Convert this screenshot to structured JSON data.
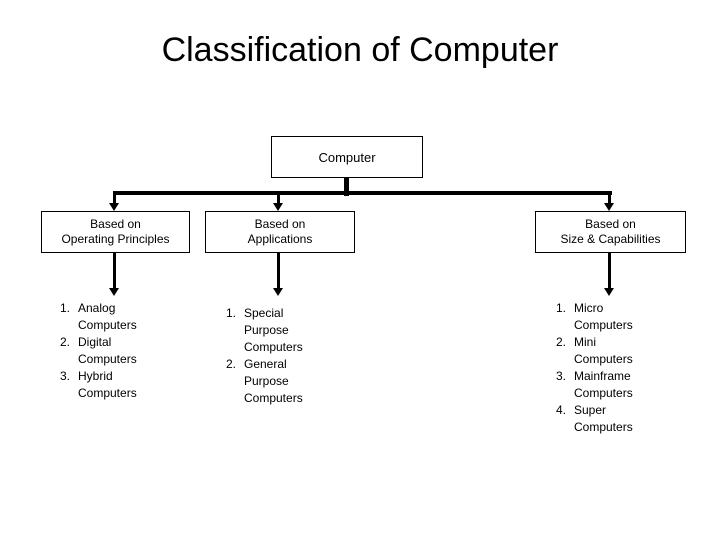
{
  "slide": {
    "title": "Classification of Computer",
    "background_color": "#ffffff",
    "text_color": "#000000"
  },
  "diagram": {
    "root": {
      "label": "Computer"
    },
    "branches": [
      {
        "box_label": "Based on\nOperating Principles",
        "items": [
          {
            "num": "1.",
            "text": "Analog\nComputers"
          },
          {
            "num": "2.",
            "text": "Digital\nComputers"
          },
          {
            "num": "3.",
            "text": "Hybrid\nComputers"
          }
        ]
      },
      {
        "box_label": "Based on\nApplications",
        "items": [
          {
            "num": "1.",
            "text": "Special\nPurpose\nComputers"
          },
          {
            "num": "2.",
            "text": "General\nPurpose\nComputers"
          }
        ]
      },
      {
        "box_label": "Based on\nSize & Capabilities",
        "items": [
          {
            "num": "1.",
            "text": "Micro\nComputers"
          },
          {
            "num": "2.",
            "text": "Mini\nComputers"
          },
          {
            "num": "3.",
            "text": "Mainframe\nComputers"
          },
          {
            "num": "4.",
            "text": "Super\nComputers"
          }
        ]
      }
    ]
  }
}
